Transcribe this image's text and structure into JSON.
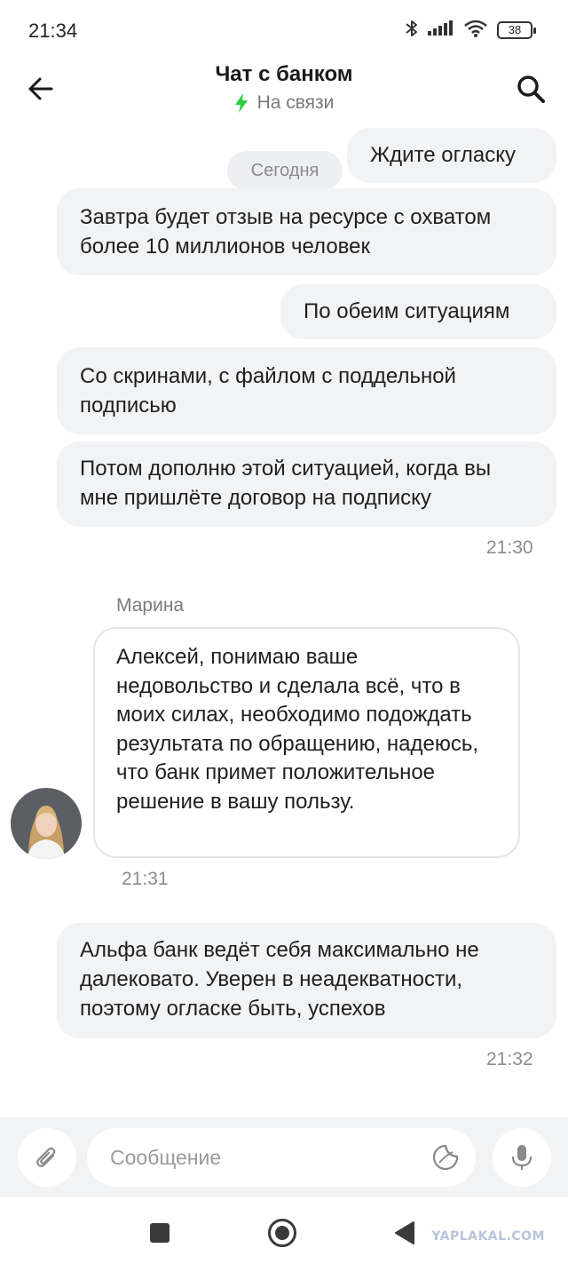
{
  "status_bar": {
    "time": "21:34",
    "battery": "38",
    "icons": [
      "bluetooth-icon",
      "signal-icon",
      "wifi-icon",
      "battery-icon"
    ]
  },
  "header": {
    "title": "Чат с банком",
    "status": "На связи",
    "status_color": "#2ecc40"
  },
  "messages": {
    "m1": "Ждите огласку",
    "date_divider": "Сегодня",
    "m2": "Завтра будет отзыв на ресурсе с охватом более 10 миллионов человек",
    "m3": "По обеим ситуациям",
    "m4": "Со скринами, с файлом с поддельной подписью",
    "m5": "Потом дополню этой ситуацией, когда вы мне пришлёте договор на подписку",
    "time1": "21:30",
    "operator_name": "Марина",
    "operator_text": "Алексей, понимаю ваше недовольство и сделала всё, что в моих силах, необходимо подождать результата по обращению, надеюсь, что банк примет положительное решение в вашу пользу.",
    "time2": "21:31",
    "m6": "Альфа банк ведёт себя максимально не далековато. Уверен в неадекватности, поэтому огласке быть, успехов",
    "time3": "21:32"
  },
  "input": {
    "placeholder": "Сообщение"
  },
  "nav": {
    "watermark": "YAPLAKAL.COM"
  }
}
